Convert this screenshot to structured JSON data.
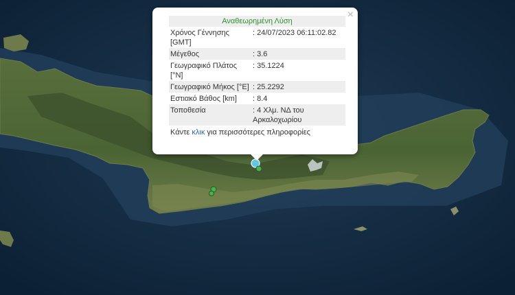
{
  "popup": {
    "title": "Αναθεωρημένη Λύση",
    "close_symbol": "×",
    "rows": [
      {
        "label": "Χρόνος Γέννησης [GMT]",
        "value": ": 24/07/2023 06:11:02.82"
      },
      {
        "label": "Μέγεθος",
        "value": ": 3.6"
      },
      {
        "label": "Γεωγραφικό Πλάτος [°N]",
        "value": ": 35.1224"
      },
      {
        "label": "Γεωγραφικό Μήκος [°E]",
        "value": ": 25.2292"
      },
      {
        "label": "Εστιακό Βάθος [km]",
        "value": ": 8.4"
      },
      {
        "label": "Τοποθεσία",
        "value": ": 4 Χλμ. ΝΔ του Αρκαλοχωρίου"
      }
    ],
    "more_prefix": "Κάντε ",
    "more_link": "κλικ",
    "more_suffix": " για περισσότερες πληροφορίες"
  },
  "map": {
    "colors": {
      "sea_deep": "#0d2236",
      "sea_shallow": "#2b4a66",
      "land": "#4f6a3a",
      "land_dark": "#3c5530",
      "land_light": "#7c8a58",
      "selected_marker": "#5bc8e6",
      "other_marker": "#4caf50"
    }
  }
}
